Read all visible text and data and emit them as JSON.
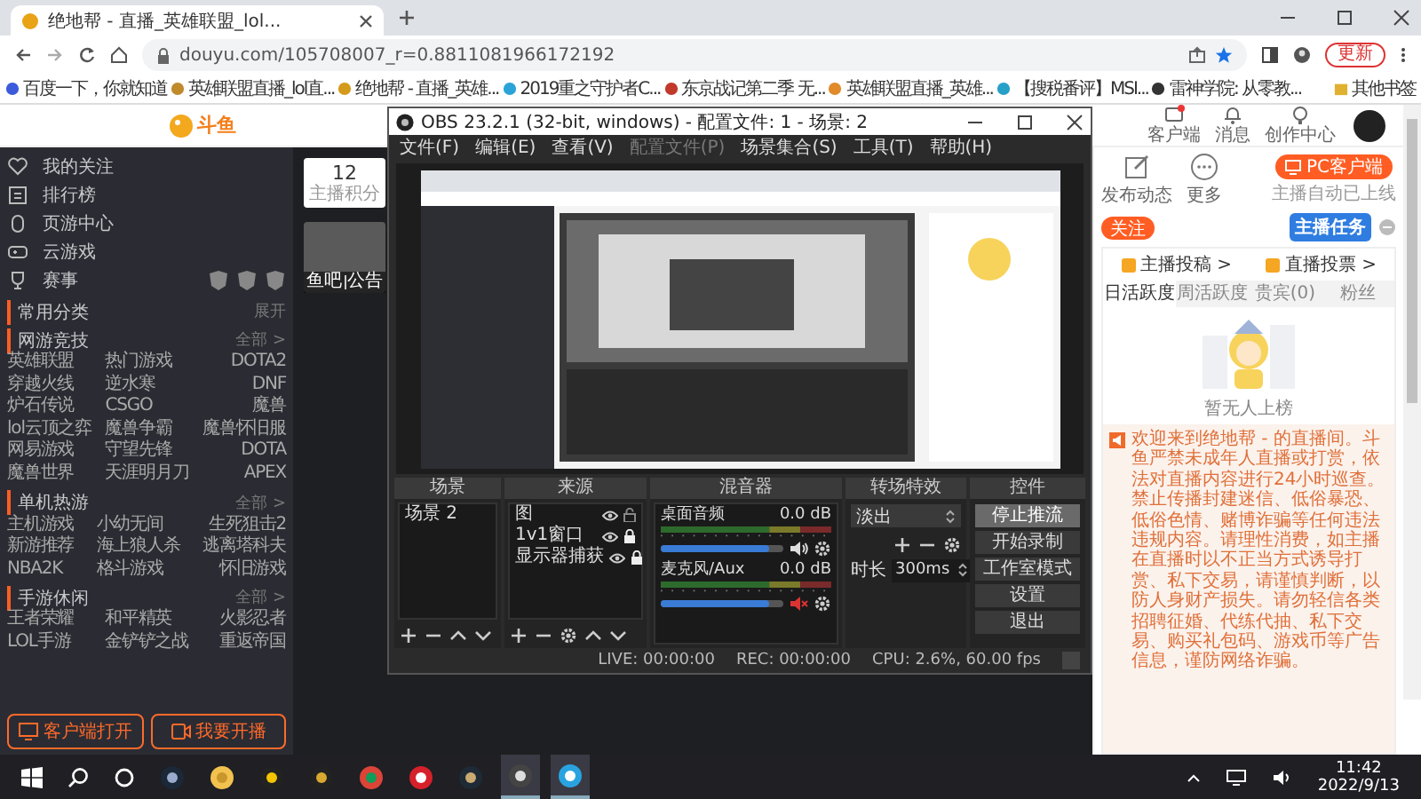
{
  "browser": {
    "tab_title": "绝地帮 - 直播_英雄联盟_lol...",
    "url": "douyu.com/105708007_r=0.8811081966172192",
    "update_button": "更新",
    "bookmarks": [
      "百度一下，你就知道",
      "英雄联盟直播_lol直...",
      "绝地帮 - 直播_英雄...",
      "2019重之守护者C...",
      "东京战记第二季 无...",
      "英雄联盟直播_英雄...",
      "【搜税番评】MSI...",
      "雷神学院: 从零教...",
      "其他书签"
    ]
  },
  "site_header": {
    "logo": "斗鱼",
    "actions": [
      {
        "kind": "client",
        "label": "客户端"
      },
      {
        "kind": "bell",
        "label": "消息"
      },
      {
        "kind": "bulb",
        "label": "创作中心"
      }
    ]
  },
  "sidebar": {
    "nav": [
      {
        "kind": "heart",
        "label": "我的关注"
      },
      {
        "kind": "rank",
        "label": "排行榜"
      },
      {
        "kind": "mouse",
        "label": "页游中心"
      },
      {
        "kind": "gamepad",
        "label": "云游戏"
      },
      {
        "kind": "trophy",
        "label": "赛事"
      }
    ],
    "sections": [
      {
        "title": "常用分类",
        "action": "展开"
      },
      {
        "title": "网游竞技",
        "action": "全部 >",
        "items": [
          "英雄联盟",
          "热门游戏",
          "DOTA2",
          "穿越火线",
          "逆水寒",
          "DNF",
          "炉石传说",
          "CSGO",
          "魔兽",
          "lol云顶之弈",
          "魔兽争霸",
          "魔兽怀旧服",
          "网易游戏",
          "守望先锋",
          "DOTA",
          "魔兽世界",
          "天涯明月刀",
          "APEX"
        ]
      },
      {
        "title": "单机热游",
        "action": "全部 >",
        "items": [
          "主机游戏",
          "小幼无间",
          "生死狙击2",
          "新游推荐",
          "海上狼人杀",
          "逃离塔科夫",
          "NBA2K",
          "格斗游戏",
          "怀旧游戏"
        ]
      },
      {
        "title": "手游休闲",
        "action": "全部 >",
        "items": [
          "王者荣耀",
          "和平精英",
          "火影忍者",
          "LOL手游",
          "金铲铲之战",
          "重返帝国"
        ]
      }
    ],
    "buttons": [
      {
        "kind": "monitor",
        "label": "客户端打开"
      },
      {
        "kind": "camera",
        "label": "我要开播"
      }
    ]
  },
  "streamer": {
    "score": "12",
    "score_label": "主播积分",
    "avatar_tabs": [
      "鱼吧",
      "公告"
    ]
  },
  "obs": {
    "title": "OBS 23.2.1 (32-bit, windows) - 配置文件: 1 - 场景: 2",
    "menu": [
      {
        "label": "文件(F)",
        "disabled": false
      },
      {
        "label": "编辑(E)",
        "disabled": false
      },
      {
        "label": "查看(V)",
        "disabled": false
      },
      {
        "label": "配置文件(P)",
        "disabled": true
      },
      {
        "label": "场景集合(S)",
        "disabled": false
      },
      {
        "label": "工具(T)",
        "disabled": false
      },
      {
        "label": "帮助(H)",
        "disabled": false
      }
    ],
    "docks": {
      "scenes": "场景",
      "sources": "来源",
      "mixer": "混音器",
      "transitions": "转场特效",
      "controls": "控件"
    },
    "scenes": [
      "场景 2"
    ],
    "sources": [
      {
        "name": "图",
        "visible": true,
        "locked": false
      },
      {
        "name": "1v1窗口",
        "visible": true,
        "locked": true
      },
      {
        "name": "显示器捕获",
        "visible": true,
        "locked": true
      }
    ],
    "mixer": [
      {
        "name": "桌面音频",
        "reading": "0.0 dB",
        "level": 0.88,
        "muted": false
      },
      {
        "name": "麦克风/Aux",
        "reading": "0.0 dB",
        "level": 0.88,
        "muted": true
      }
    ],
    "transition": {
      "value": "淡出",
      "duration_label": "时长",
      "duration": "300ms"
    },
    "controls": [
      {
        "label": "停止推流",
        "active": true
      },
      {
        "label": "开始录制",
        "active": false
      },
      {
        "label": "工作室模式",
        "active": false
      },
      {
        "label": "设置",
        "active": false
      },
      {
        "label": "退出",
        "active": false
      }
    ],
    "status": [
      "LIVE: 00:00:00",
      "REC: 00:00:00",
      "CPU: 2.6%, 60.00 fps"
    ]
  },
  "side_panel": {
    "actions": [
      {
        "kind": "edit",
        "label": "发布动态"
      },
      {
        "kind": "more",
        "label": "更多"
      }
    ],
    "pc_button": "PC客户端",
    "pc_note": "主播自动已上线",
    "follow_button": "关注",
    "task_badge": "主播任务",
    "links": [
      "主播投稿 >",
      "直播投票 >"
    ],
    "tabs": [
      {
        "label": "日活跃度",
        "selected": true
      },
      {
        "label": "周活跃度",
        "selected": false
      },
      {
        "label": "贵宾(0)",
        "selected": false
      },
      {
        "label": "粉丝",
        "selected": false
      }
    ],
    "empty_text": "暂无人上榜",
    "notice": "欢迎来到绝地帮 - 的直播间。斗鱼严禁未成年人直播或打赏，依法对直播内容进行24小时巡查。禁止传播封建迷信、低俗暴恐、低俗色情、赌博诈骗等任何违法违规内容。请理性消费，如主播在直播时以不正当方式诱导打赏、私下交易，请谨慎判断，以防人身财产损失。请勿轻信各类招聘征婚、代练代抽、私下交易、购买礼包码、游戏币等广告信息，谨防网络诈骗。"
  },
  "taskbar": {
    "time": "11:42",
    "date": "2022/9/13"
  }
}
